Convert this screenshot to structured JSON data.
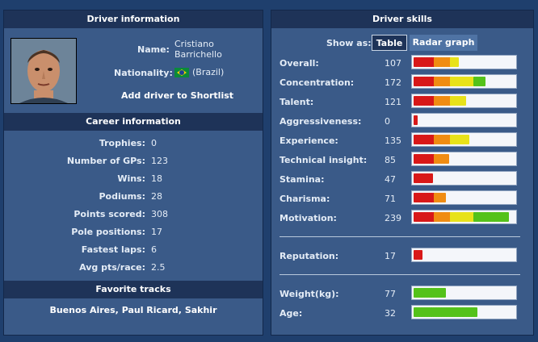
{
  "driver_info": {
    "header": "Driver information",
    "name_label": "Name:",
    "name_first": "Cristiano",
    "name_last": "Barrichello",
    "nationality_label": "Nationality:",
    "nationality_value": "(Brazil)",
    "add_shortlist": "Add driver to Shortlist"
  },
  "career": {
    "header": "Career information",
    "rows": [
      {
        "label": "Trophies:",
        "value": "0"
      },
      {
        "label": "Number of GPs:",
        "value": "123"
      },
      {
        "label": "Wins:",
        "value": "18"
      },
      {
        "label": "Podiums:",
        "value": "28"
      },
      {
        "label": "Points scored:",
        "value": "308"
      },
      {
        "label": "Pole positions:",
        "value": "17"
      },
      {
        "label": "Fastest laps:",
        "value": "6"
      },
      {
        "label": "Avg pts/race:",
        "value": "2.5"
      }
    ]
  },
  "favorite_tracks": {
    "header": "Favorite tracks",
    "tracks": [
      "Buenos Aires",
      "Paul Ricard",
      "Sakhir"
    ],
    "separator": ", "
  },
  "skills": {
    "header": "Driver skills",
    "show_as_label": "Show as:",
    "tab_table": "Table",
    "tab_radar": "Radar graph",
    "rows": [
      {
        "label": "Overall:",
        "value": "107",
        "level": 0.45,
        "scheme": "skill"
      },
      {
        "label": "Concentration:",
        "value": "172",
        "level": 0.72,
        "scheme": "skill"
      },
      {
        "label": "Talent:",
        "value": "121",
        "level": 0.53,
        "scheme": "skill"
      },
      {
        "label": "Aggressiveness:",
        "value": "0",
        "level": 0.03,
        "scheme": "skill"
      },
      {
        "label": "Experience:",
        "value": "135",
        "level": 0.56,
        "scheme": "skill"
      },
      {
        "label": "Technical insight:",
        "value": "85",
        "level": 0.36,
        "scheme": "skill"
      },
      {
        "label": "Stamina:",
        "value": "47",
        "level": 0.2,
        "scheme": "skill"
      },
      {
        "label": "Charisma:",
        "value": "71",
        "level": 0.33,
        "scheme": "skill"
      },
      {
        "label": "Motivation:",
        "value": "239",
        "level": 0.97,
        "scheme": "skill"
      }
    ],
    "reputation": {
      "label": "Reputation:",
      "value": "17",
      "level": 0.08,
      "scheme": "skill"
    },
    "physical": [
      {
        "label": "Weight(kg):",
        "value": "77",
        "level": 0.33,
        "scheme": "green"
      },
      {
        "label": "Age:",
        "value": "32",
        "level": 0.64,
        "scheme": "green"
      }
    ]
  },
  "colors": {
    "panel": "#3a5a88",
    "header": "#1e3358",
    "seg_red": "#d81818",
    "seg_orange": "#f08c12",
    "seg_yellow": "#e8e21a",
    "seg_green": "#54c21a"
  }
}
